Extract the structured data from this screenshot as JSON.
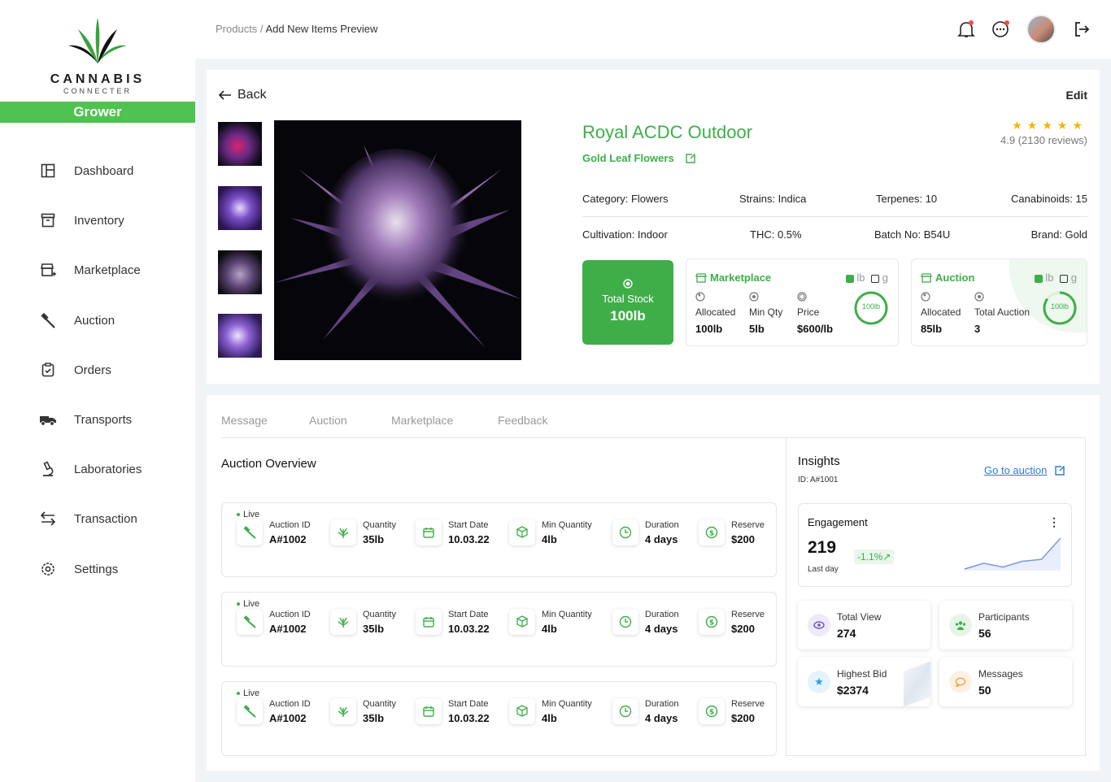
{
  "brand": {
    "word": "CANNABIS",
    "sub": "CONNECTER",
    "role": "Grower"
  },
  "nav": [
    {
      "label": "Dashboard",
      "icon": "dashboard-icon"
    },
    {
      "label": "Inventory",
      "icon": "inventory-icon"
    },
    {
      "label": "Marketplace",
      "icon": "marketplace-icon"
    },
    {
      "label": "Auction",
      "icon": "gavel-icon"
    },
    {
      "label": "Orders",
      "icon": "clipboard-icon"
    },
    {
      "label": "Transports",
      "icon": "truck-icon"
    },
    {
      "label": "Laboratories",
      "icon": "microscope-icon"
    },
    {
      "label": "Transaction",
      "icon": "transfer-icon"
    },
    {
      "label": "Settings",
      "icon": "gear-icon"
    }
  ],
  "breadcrumb": {
    "parent": "Products",
    "sep": " / ",
    "current": "Add New Items Preview"
  },
  "product": {
    "back": "Back",
    "edit": "Edit",
    "title": "Royal ACDC Outdoor",
    "seller": "Gold Leaf Flowers",
    "rating": "4.9 (2130 reviews)",
    "attrs1": [
      "Category: Flowers",
      "Strains: Indica",
      "Terpenes: 10",
      "Canabinoids: 15"
    ],
    "attrs2": [
      "Cultivation: Indoor",
      "THC: 0.5%",
      "Batch No: B54U",
      "Brand: Gold"
    ],
    "total_stock_label": "Total Stock",
    "total_stock_value": "100lb",
    "marketplace": {
      "title": "Marketplace",
      "unit_lb": "lb",
      "unit_g": "g",
      "allocated_label": "Allocated",
      "allocated_value": "100lb",
      "minqty_label": "Min Qty",
      "minqty_value": "5lb",
      "price_label": "Price",
      "price_value": "$600/lb",
      "ring_label": "100lb",
      "ring_fraction": 1.0
    },
    "auction": {
      "title": "Auction",
      "unit_lb": "lb",
      "unit_g": "g",
      "allocated_label": "Allocated",
      "allocated_value": "85lb",
      "total_label": "Total Auction",
      "total_value": "3",
      "ring_label": "100lb",
      "ring_fraction": 0.85
    }
  },
  "tabs": [
    "Message",
    "Auction",
    "Marketplace",
    "Feedback"
  ],
  "overview": {
    "title": "Auction Overview",
    "rows": [
      {
        "status": "Live",
        "auction_id": "A#1002",
        "quantity": "35lb",
        "start": "10.03.22",
        "min": "4lb",
        "duration": "4 days",
        "reserve": "$200"
      },
      {
        "status": "Live",
        "auction_id": "A#1002",
        "quantity": "35lb",
        "start": "10.03.22",
        "min": "4lb",
        "duration": "4 days",
        "reserve": "$200"
      },
      {
        "status": "Live",
        "auction_id": "A#1002",
        "quantity": "35lb",
        "start": "10.03.22",
        "min": "4lb",
        "duration": "4 days",
        "reserve": "$200"
      }
    ],
    "labels": {
      "auction_id": "Auction ID",
      "quantity": "Quantity",
      "start": "Start Date",
      "min": "Min Quantity",
      "duration": "Duration",
      "reserve": "Reserve"
    }
  },
  "insights": {
    "title": "Insights",
    "id": "ID: A#1001",
    "link": "Go to auction",
    "engagement": {
      "title": "Engagement",
      "value": "219",
      "change": "-1.1%",
      "period": "Last day",
      "spark": [
        2,
        5,
        3,
        6,
        7,
        18
      ]
    },
    "stats": [
      {
        "label": "Total View",
        "value": "274"
      },
      {
        "label": "Participants",
        "value": "56"
      },
      {
        "label": "Highest Bid",
        "value": "$2374"
      },
      {
        "label": "Messages",
        "value": "50"
      }
    ]
  },
  "colors": {
    "accent": "#3fae49",
    "grower_bar": "#4fc34f",
    "link": "#2a7bd5"
  }
}
